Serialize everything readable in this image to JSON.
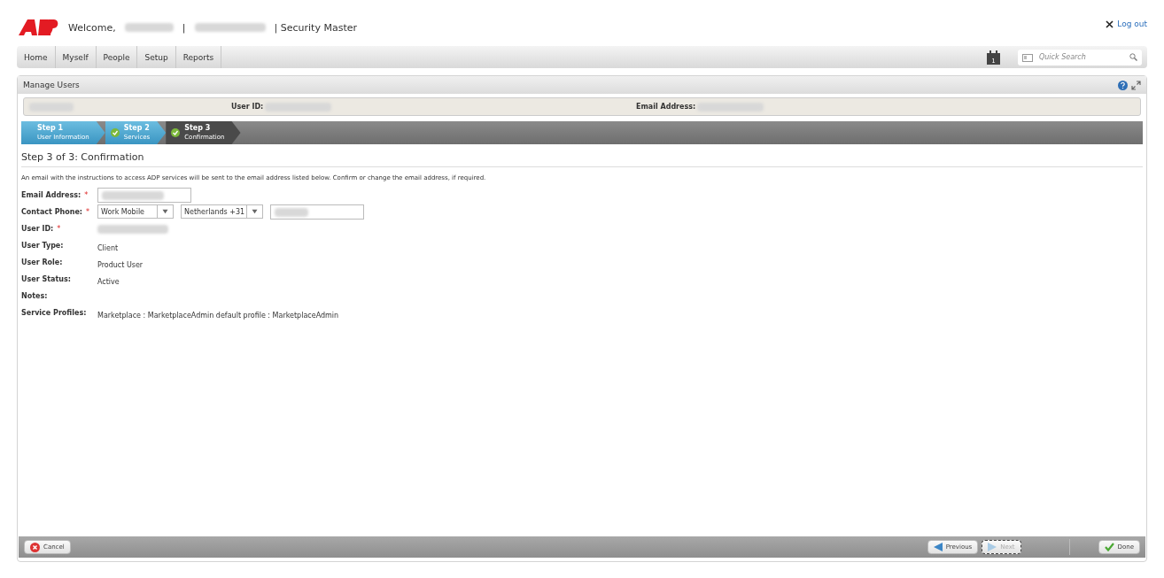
{
  "header": {
    "welcome": "Welcome,",
    "separator": "|",
    "role": "| Security Master",
    "logout": "Log out"
  },
  "nav": {
    "items": [
      "Home",
      "Myself",
      "People",
      "Setup",
      "Reports"
    ],
    "calendar_day": "1",
    "search": {
      "placeholder": "Quick Search"
    }
  },
  "panel": {
    "title": "Manage Users",
    "info_bar": [
      {
        "label": "User ID:"
      },
      {
        "label": "Email Address:"
      }
    ],
    "steps": [
      {
        "step": "Step 1",
        "label": "User Information",
        "checked": false,
        "selected": false
      },
      {
        "step": "Step 2",
        "label": "Services",
        "checked": true,
        "selected": false
      },
      {
        "step": "Step 3",
        "label": "Confirmation",
        "checked": true,
        "selected": true
      }
    ],
    "heading": "Step 3 of 3: Confirmation",
    "intro": "An email with the instructions to access ADP services will be sent to the email address listed below. Confirm or change the email address, if required.",
    "fields": [
      {
        "kind": "input",
        "label": "Email Address:",
        "required_mark": "*"
      },
      {
        "kind": "phone",
        "label": "Contact Phone:",
        "required_mark": "*",
        "phone_type": "Work Mobile",
        "country": "Netherlands +31"
      },
      {
        "kind": "redacted",
        "label": "User ID:",
        "required_mark": "*"
      },
      {
        "kind": "text",
        "label": "User Type:",
        "value": "Client"
      },
      {
        "kind": "text",
        "label": "User Role:",
        "value": "Product User"
      },
      {
        "kind": "text",
        "label": "User Status:",
        "value": "Active"
      },
      {
        "kind": "text",
        "label": "Notes:"
      },
      {
        "kind": "text",
        "label": "Service Profiles:",
        "value": "Marketplace : MarketplaceAdmin default profile : MarketplaceAdmin"
      }
    ],
    "footer": {
      "left": [
        {
          "kind": "cancel",
          "label": "Cancel",
          "disabled": false
        }
      ],
      "right": [
        {
          "kind": "previous",
          "label": "Previous",
          "disabled": false
        },
        {
          "kind": "next",
          "label": "Next",
          "disabled": true
        },
        {
          "kind": "done",
          "label": "Done",
          "disabled": false
        }
      ]
    }
  }
}
